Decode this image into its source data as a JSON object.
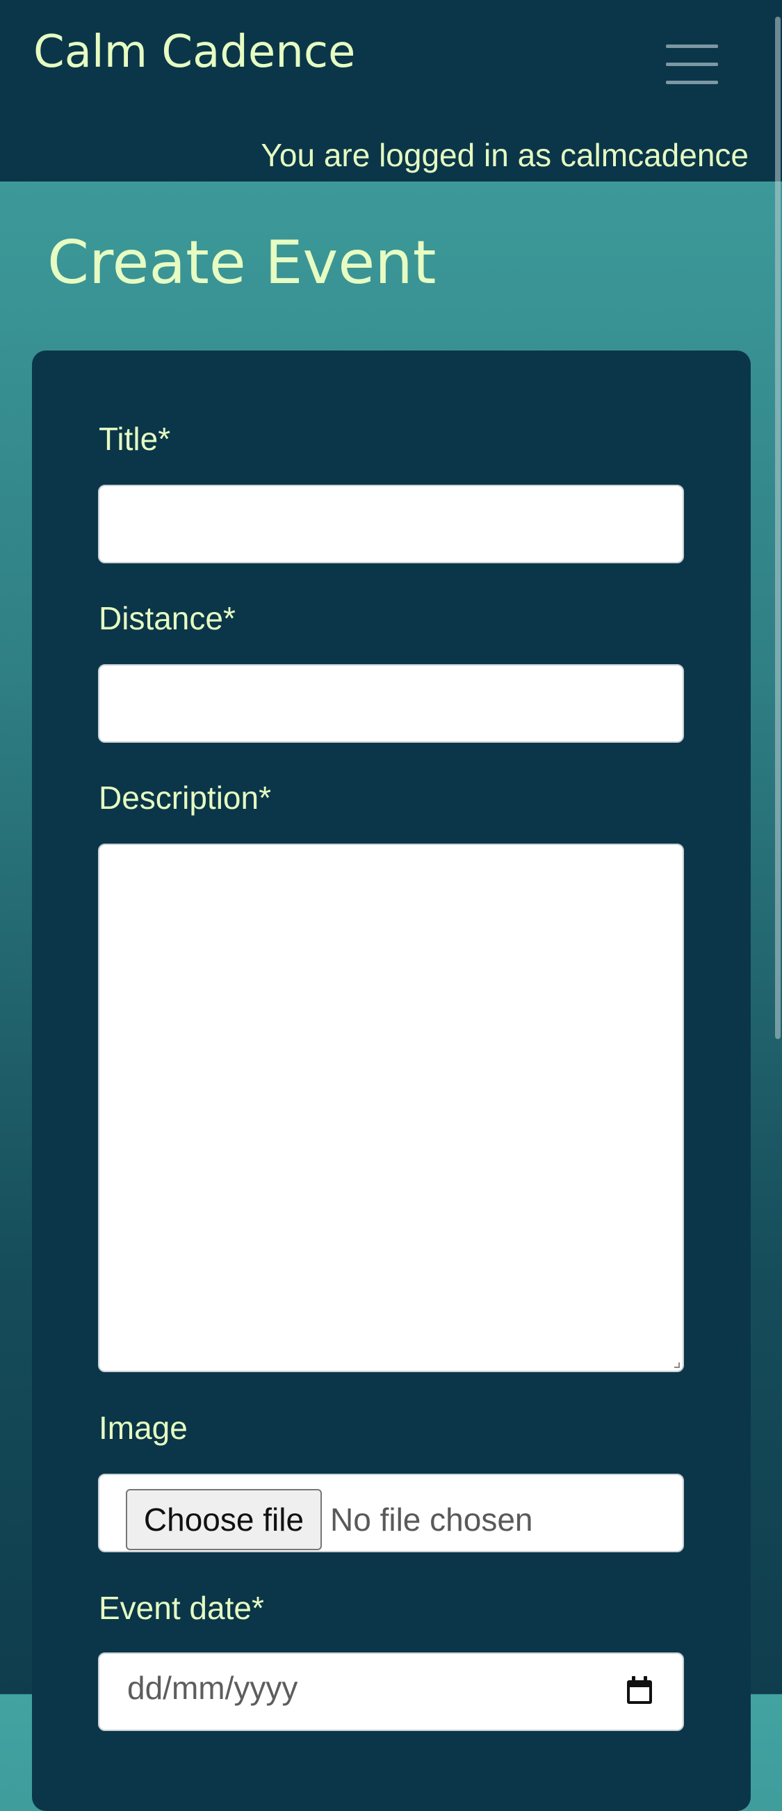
{
  "navbar": {
    "brand": "Calm Cadence",
    "toggler_icon": "hamburger-menu-icon",
    "login_status": "You are logged in as calmcadence"
  },
  "page": {
    "title": "Create Event"
  },
  "form": {
    "title_label": "Title*",
    "title_value": "",
    "distance_label": "Distance*",
    "distance_value": "",
    "description_label": "Description*",
    "description_value": "",
    "image_label": "Image",
    "file_button_label": "Choose file",
    "file_status": "No file chosen",
    "event_date_label": "Event date*",
    "event_date_placeholder": "dd/mm/yyyy",
    "calendar_icon": "calendar-icon"
  },
  "colors": {
    "navbar_bg": "#0b3649",
    "accent_text": "#e6fcc2",
    "card_bg": "#0b3649",
    "gradient_top": "#42a3a1",
    "gradient_bottom": "#0f3d4d"
  }
}
